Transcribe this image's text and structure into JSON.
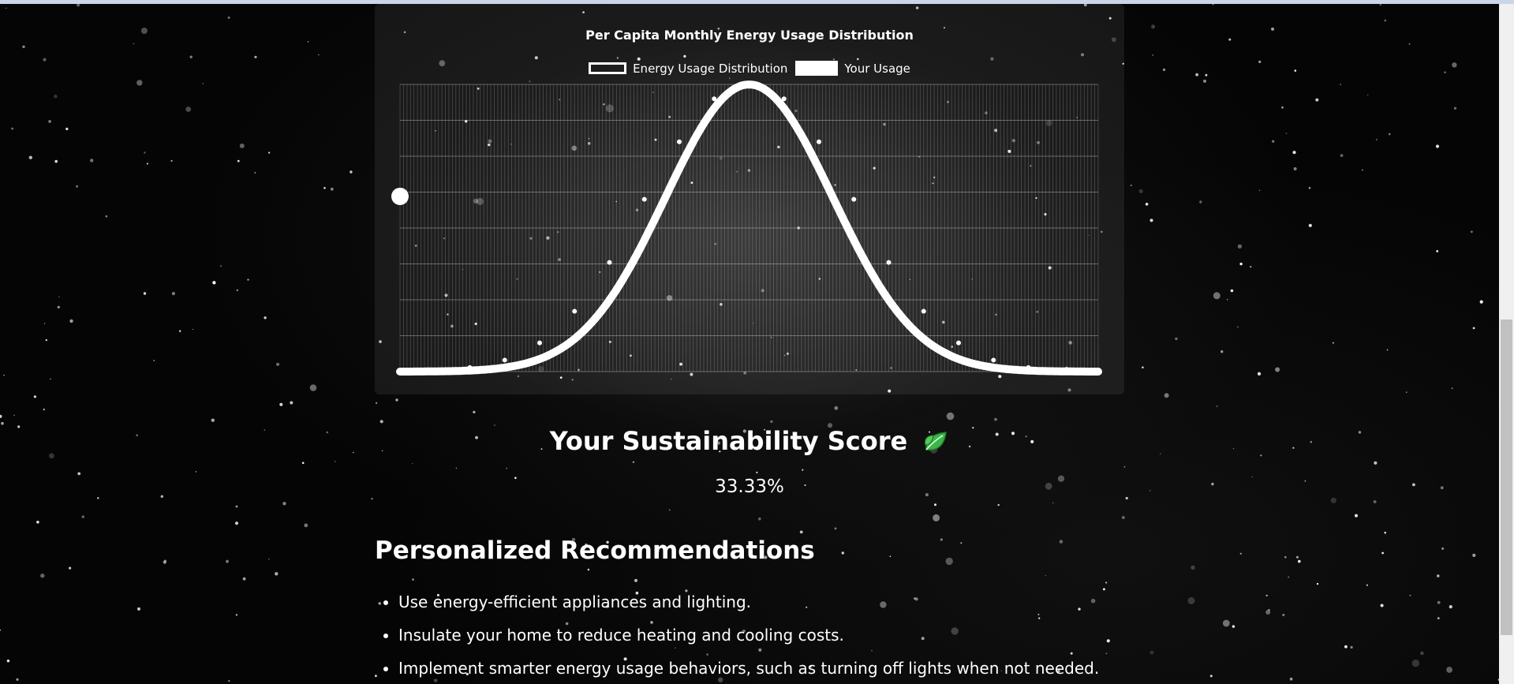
{
  "chart_data": {
    "type": "line",
    "title": "Per Capita Monthly Energy Usage Distribution",
    "legend": [
      "Energy Usage Distribution",
      "Your Usage"
    ],
    "legend_position": "top",
    "grid": true,
    "series": [
      {
        "name": "Energy Usage Distribution",
        "shape": "normal-distribution",
        "x": [
          0,
          0.05,
          0.1,
          0.15,
          0.2,
          0.25,
          0.3,
          0.35,
          0.4,
          0.45,
          0.5,
          0.55,
          0.6,
          0.65,
          0.7,
          0.75,
          0.8,
          0.85,
          0.9,
          0.95,
          1.0
        ],
        "values": [
          0.0,
          0.004,
          0.014,
          0.04,
          0.1,
          0.21,
          0.38,
          0.6,
          0.8,
          0.95,
          1.0,
          0.95,
          0.8,
          0.6,
          0.38,
          0.21,
          0.1,
          0.04,
          0.014,
          0.004,
          0.0
        ]
      },
      {
        "name": "Your Usage",
        "x": [
          0
        ],
        "values": [
          0.61
        ]
      }
    ],
    "ylim": [
      0,
      1
    ]
  },
  "score": {
    "title": "Your Sustainability Score",
    "icon": "leaf-icon",
    "value": "33.33%"
  },
  "recommendations": {
    "heading": "Personalized Recommendations",
    "items": [
      "Use energy-efficient appliances and lighting.",
      "Insulate your home to reduce heating and cooling costs.",
      "Implement smarter energy usage behaviors, such as turning off lights when not needed."
    ]
  }
}
